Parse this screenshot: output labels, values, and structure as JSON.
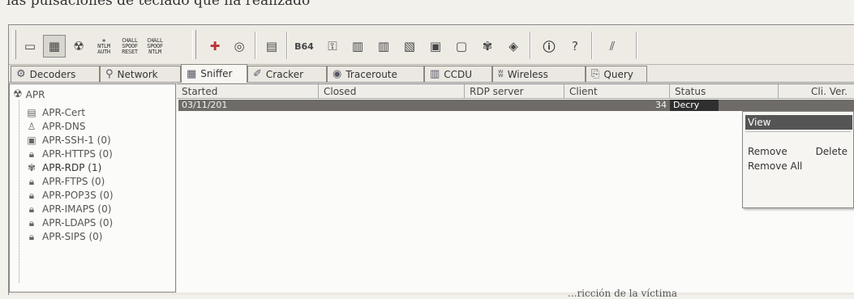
{
  "caption_top": "las pulsaciones de teclado que ha realizado",
  "caption_bottom": "...ricción de la víctima",
  "toolbar": {
    "ntlm_auth": [
      "NTLM",
      "AUTH"
    ],
    "chall_spoof_reset": [
      "CHALL",
      "SPOOF",
      "RESET"
    ],
    "chall_spoof_ntlm": [
      "CHALL",
      "SPOOF",
      "NTLM"
    ],
    "b64_label": "B64",
    "icons": [
      "open-icon",
      "sniffer-icon",
      "apr-icon",
      "ntlm-auth-icon",
      "chall-spoof-reset-icon",
      "chall-spoof-ntlm-icon",
      "add-icon",
      "cert-icon",
      "grid-icon",
      "base64-icon",
      "key-icon",
      "hash-icon",
      "hash2-icon",
      "ntlm-hash-icon",
      "terminal-icon",
      "monitor-icon",
      "gear-icon",
      "lock-icon",
      "info-icon",
      "help-icon",
      "query-icon"
    ]
  },
  "tabs": [
    {
      "label": "Decoders",
      "icon": "decoders-icon"
    },
    {
      "label": "Network",
      "icon": "network-icon"
    },
    {
      "label": "Sniffer",
      "icon": "sniffer-icon",
      "active": true
    },
    {
      "label": "Cracker",
      "icon": "cracker-icon"
    },
    {
      "label": "Traceroute",
      "icon": "traceroute-icon"
    },
    {
      "label": "CCDU",
      "icon": "ccdu-icon"
    },
    {
      "label": "Wireless",
      "icon": "wireless-icon"
    },
    {
      "label": "Query",
      "icon": "query-icon"
    }
  ],
  "tree": {
    "root": "APR",
    "items": [
      "APR-Cert",
      "APR-DNS",
      "APR-SSH-1 (0)",
      "APR-HTTPS (0)",
      "APR-RDP (1)",
      "APR-FTPS (0)",
      "APR-POP3S (0)",
      "APR-IMAPS (0)",
      "APR-LDAPS (0)",
      "APR-SIPS (0)"
    ]
  },
  "table": {
    "headers": [
      "Started",
      "Closed",
      "RDP server",
      "Client",
      "Status",
      "Cli. Ver."
    ],
    "row": {
      "started": "03/11/201",
      "closed": "",
      "rdp_server": "",
      "client": "34",
      "status": "Decry",
      "cli_ver": ""
    }
  },
  "context_menu": {
    "view": "View",
    "remove": "Remove",
    "delete": "Delete",
    "remove_all": "Remove All"
  },
  "colors": {
    "selection": "#6f6c68",
    "menu_highlight": "#555555"
  }
}
